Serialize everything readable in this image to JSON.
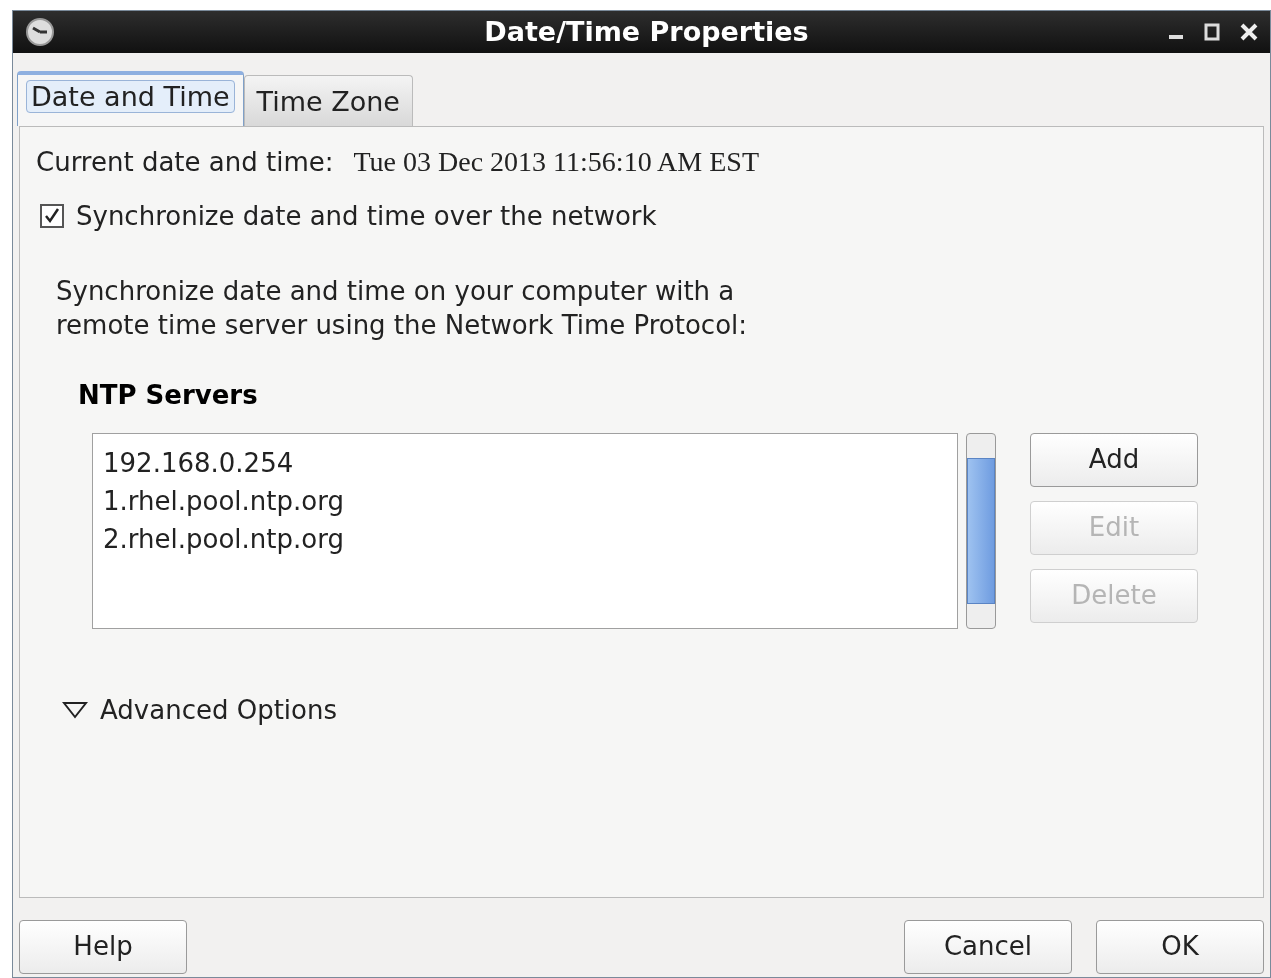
{
  "window": {
    "title": "Date/Time Properties"
  },
  "tabs": [
    {
      "label": "Date and Time",
      "selected": true
    },
    {
      "label": "Time Zone",
      "selected": false
    }
  ],
  "current": {
    "label": "Current date and time:",
    "value": "Tue 03 Dec 2013 11:56:10 AM EST"
  },
  "sync": {
    "label": "Synchronize date and time over the network",
    "checked": true
  },
  "description": "Synchronize date and time on your computer with a remote time server using the Network Time Protocol:",
  "ntp": {
    "heading": "NTP Servers",
    "servers": [
      "192.168.0.254",
      "1.rhel.pool.ntp.org",
      "2.rhel.pool.ntp.org"
    ],
    "buttons": [
      {
        "label": "Add",
        "disabled": false
      },
      {
        "label": "Edit",
        "disabled": true
      },
      {
        "label": "Delete",
        "disabled": true
      }
    ]
  },
  "advanced": {
    "label": "Advanced Options",
    "expanded": true
  },
  "footer": {
    "left": [
      {
        "label": "Help"
      }
    ],
    "right": [
      {
        "label": "Cancel"
      },
      {
        "label": "OK"
      }
    ]
  }
}
